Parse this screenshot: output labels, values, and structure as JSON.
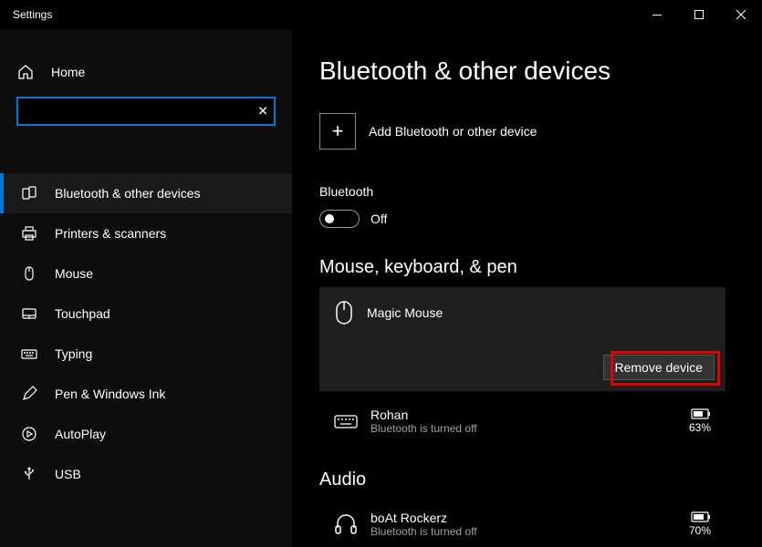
{
  "window": {
    "title": "Settings"
  },
  "sidebar": {
    "home": "Home",
    "search_placeholder": "",
    "items": [
      {
        "label": "Bluetooth & other devices",
        "icon": "bluetooth",
        "active": true
      },
      {
        "label": "Printers & scanners",
        "icon": "printer"
      },
      {
        "label": "Mouse",
        "icon": "mouse"
      },
      {
        "label": "Touchpad",
        "icon": "touchpad"
      },
      {
        "label": "Typing",
        "icon": "keyboard"
      },
      {
        "label": "Pen & Windows Ink",
        "icon": "pen"
      },
      {
        "label": "AutoPlay",
        "icon": "autoplay"
      },
      {
        "label": "USB",
        "icon": "usb"
      }
    ]
  },
  "content": {
    "title": "Bluetooth & other devices",
    "add_label": "Add Bluetooth or other device",
    "bluetooth_label": "Bluetooth",
    "bluetooth_state": "Off",
    "sections": {
      "mouse": {
        "title": "Mouse, keyboard, & pen",
        "devices": [
          {
            "name": "Magic  Mouse",
            "remove_label": "Remove device",
            "selected": true
          },
          {
            "name": "Rohan",
            "status": "Bluetooth is turned off",
            "battery": "63%"
          }
        ]
      },
      "audio": {
        "title": "Audio",
        "devices": [
          {
            "name": "boAt Rockerz",
            "status": "Bluetooth is turned off",
            "battery": "70%"
          }
        ]
      }
    }
  }
}
